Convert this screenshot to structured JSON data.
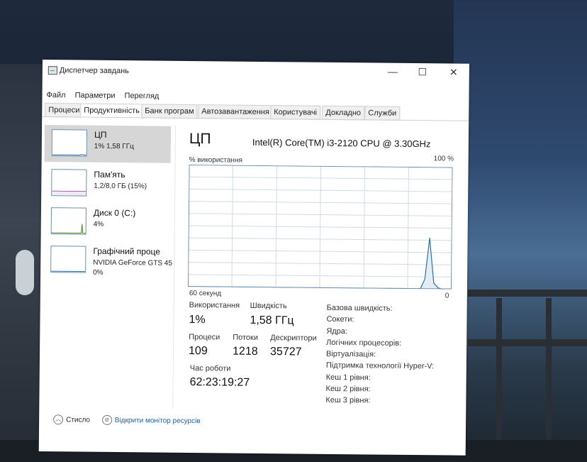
{
  "window": {
    "title": "Диспетчер завдань",
    "controls": {
      "minimize": "—",
      "maximize": "☐",
      "close": "✕"
    }
  },
  "menu": [
    "Файл",
    "Параметри",
    "Перегляд"
  ],
  "tabs": [
    "Процеси",
    "Продуктивність",
    "Банк програм",
    "Автозавантаження",
    "Користувачі",
    "Докладно",
    "Служби"
  ],
  "active_tab": "Продуктивність",
  "sidebar": [
    {
      "name": "ЦП",
      "sub": "1% 1,58 ГГц"
    },
    {
      "name": "Пам'ять",
      "sub": "1,2/8,0 ГБ (15%)"
    },
    {
      "name": "Диск 0 (C:)",
      "sub": "4%"
    },
    {
      "name": "Графічний проце",
      "sub": "NVIDIA GeForce GTS 45",
      "sub2": "0%"
    }
  ],
  "main": {
    "heading": "ЦП",
    "model": "Intel(R) Core(TM) i3-2120 CPU @ 3.30GHz",
    "usage_label": "% використання",
    "max_label": "100 %",
    "time_label": "60 секунд",
    "min_label": "0",
    "stats": {
      "usage_label": "Використання",
      "usage_value": "1%",
      "speed_label": "Швидкість",
      "speed_value": "1,58 ГГц",
      "processes_label": "Процеси",
      "processes_value": "109",
      "threads_label": "Потоки",
      "threads_value": "1218",
      "handles_label": "Дескриптори",
      "handles_value": "35727",
      "uptime_label": "Час роботи",
      "uptime_value": "62:23:19:27"
    },
    "properties": [
      "Базова швидкість:",
      "Сокети:",
      "Ядра:",
      "Логічних процесорів:",
      "Віртуалізація:",
      "Підтримка технології Hyper-V:",
      "Кеш 1 рівня:",
      "Кеш 2 рівня:",
      "Кеш 3 рівня:"
    ]
  },
  "footer": {
    "less_label": "Стисло",
    "monitor_link": "Відкрити монітор ресурсів"
  },
  "chart_data": {
    "type": "line",
    "xlabel": "60 секунд",
    "ylabel": "% використання",
    "ylim": [
      0,
      100
    ],
    "series": [
      {
        "values": [
          0,
          0,
          0,
          0,
          0,
          0,
          0,
          0,
          0,
          0,
          0,
          0,
          0,
          0,
          0,
          0,
          0,
          0,
          0,
          0,
          0,
          0,
          0,
          0,
          0,
          0,
          0,
          0,
          0,
          0,
          0,
          0,
          0,
          0,
          0,
          0,
          0,
          0,
          0,
          0,
          0,
          0,
          0,
          0,
          0,
          0,
          0,
          0,
          0,
          0,
          0,
          0,
          0,
          8,
          42,
          5,
          1,
          0,
          0,
          0
        ]
      }
    ],
    "colors": {
      "line": "#2f6fab",
      "grid": "#d0dbe6",
      "border": "#6b8faf"
    }
  }
}
